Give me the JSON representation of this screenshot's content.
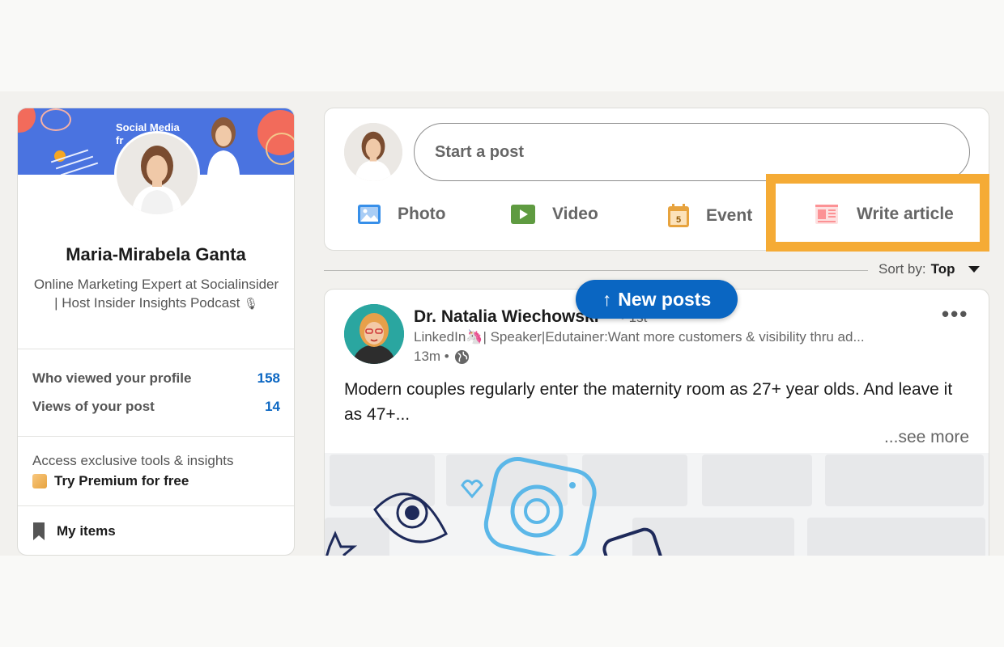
{
  "profile": {
    "banner_text": "Social Media\nfr",
    "name": "Maria-Mirabela Ganta",
    "headline": "Online Marketing Expert at Socialinsider | Host Insider Insights Podcast",
    "headline_icon": "🎙",
    "stats": [
      {
        "label": "Who viewed your profile",
        "value": "158"
      },
      {
        "label": "Views of your post",
        "value": "14"
      }
    ],
    "premium_prompt": "Access exclusive tools & insights",
    "premium_cta": "Try Premium for free",
    "my_items": "My items"
  },
  "composer": {
    "placeholder": "Start a post",
    "actions": [
      {
        "label": "Photo",
        "icon": "photo-icon",
        "color": "#378fe9"
      },
      {
        "label": "Video",
        "icon": "video-icon",
        "color": "#5f9b41"
      },
      {
        "label": "Event",
        "icon": "event-icon",
        "color": "#e7a33e"
      },
      {
        "label": "Write article",
        "icon": "article-icon",
        "color": "#fc9295"
      }
    ],
    "event_day": "5"
  },
  "sort": {
    "label": "Sort by:",
    "value": "Top"
  },
  "new_posts": {
    "label": "New posts",
    "arrow": "↑"
  },
  "post": {
    "author": "Dr. Natalia Wiechowski",
    "degree": "• 1st",
    "headline": "LinkedIn🦄| Speaker|Edutainer:Want more customers & visibility thru ad...",
    "time": "13m •",
    "text": "Modern couples regularly enter the maternity room as 27+ year olds. And leave it as 47+...",
    "see_more": "...see more",
    "menu": "•••"
  },
  "colors": {
    "accent": "#0a66c2",
    "highlight": "#f5ab35"
  }
}
